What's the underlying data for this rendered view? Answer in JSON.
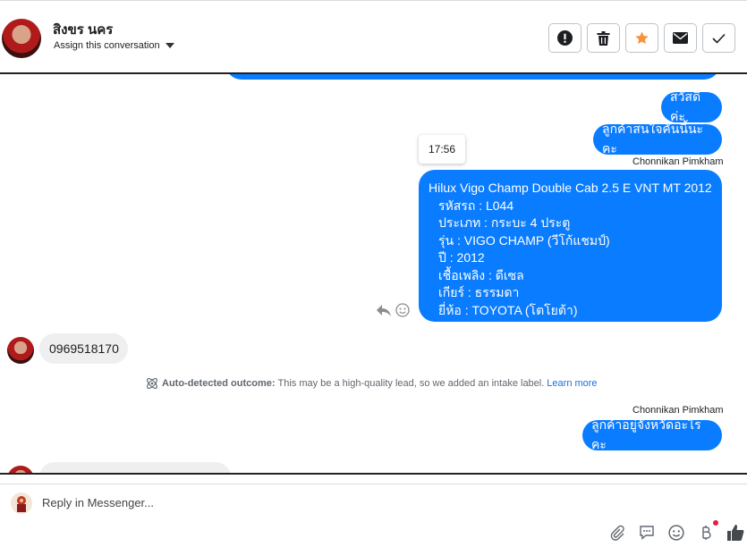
{
  "header": {
    "contact_name": "สิงขร นคร",
    "assign_label": "Assign this conversation",
    "actions": [
      "alert-icon",
      "trash-icon",
      "star-icon",
      "envelope-icon",
      "check-icon"
    ],
    "star_color": "#f7923b"
  },
  "thread": {
    "msg_hello": "สวัสดีค่ะ",
    "msg_interest": "ลูกค้าสนใจคันนี้นะคะ",
    "sender_1": "Chonnikan Pimkham",
    "time_tooltip": "17:56",
    "card": {
      "title": "Hilux Vigo Champ Double Cab 2.5 E VNT MT 2012",
      "lines": [
        "รหัสรถ : L044",
        "ประเภท : กระบะ 4 ประตู",
        "รุ่น : VIGO CHAMP (วีโก้แชมป์)",
        "ปี : 2012",
        "เชื้อเพลิง : ดีเซล",
        "เกียร์ : ธรรมดา",
        "ยี่ห้อ : TOYOTA (โตโยต้า)"
      ]
    },
    "incoming_phone": "0969518170",
    "outcome": {
      "label": "Auto-detected outcome:",
      "text": "This may be a high-quality lead, so we added an intake label.",
      "link": "Learn more"
    },
    "sender_2": "Chonnikan Pimkham",
    "msg_province": "ลูกค้าอยู่จังหวัดอะไรคะ"
  },
  "composer": {
    "placeholder": "Reply in Messenger...",
    "tools": [
      "paperclip-icon",
      "comment-icon",
      "emoji-icon",
      "baht-icon",
      "thumbs-up-icon"
    ]
  },
  "colors": {
    "outgoing_bubble": "#0a7cff",
    "incoming_bubble": "#efefef",
    "link": "#216fdb"
  }
}
